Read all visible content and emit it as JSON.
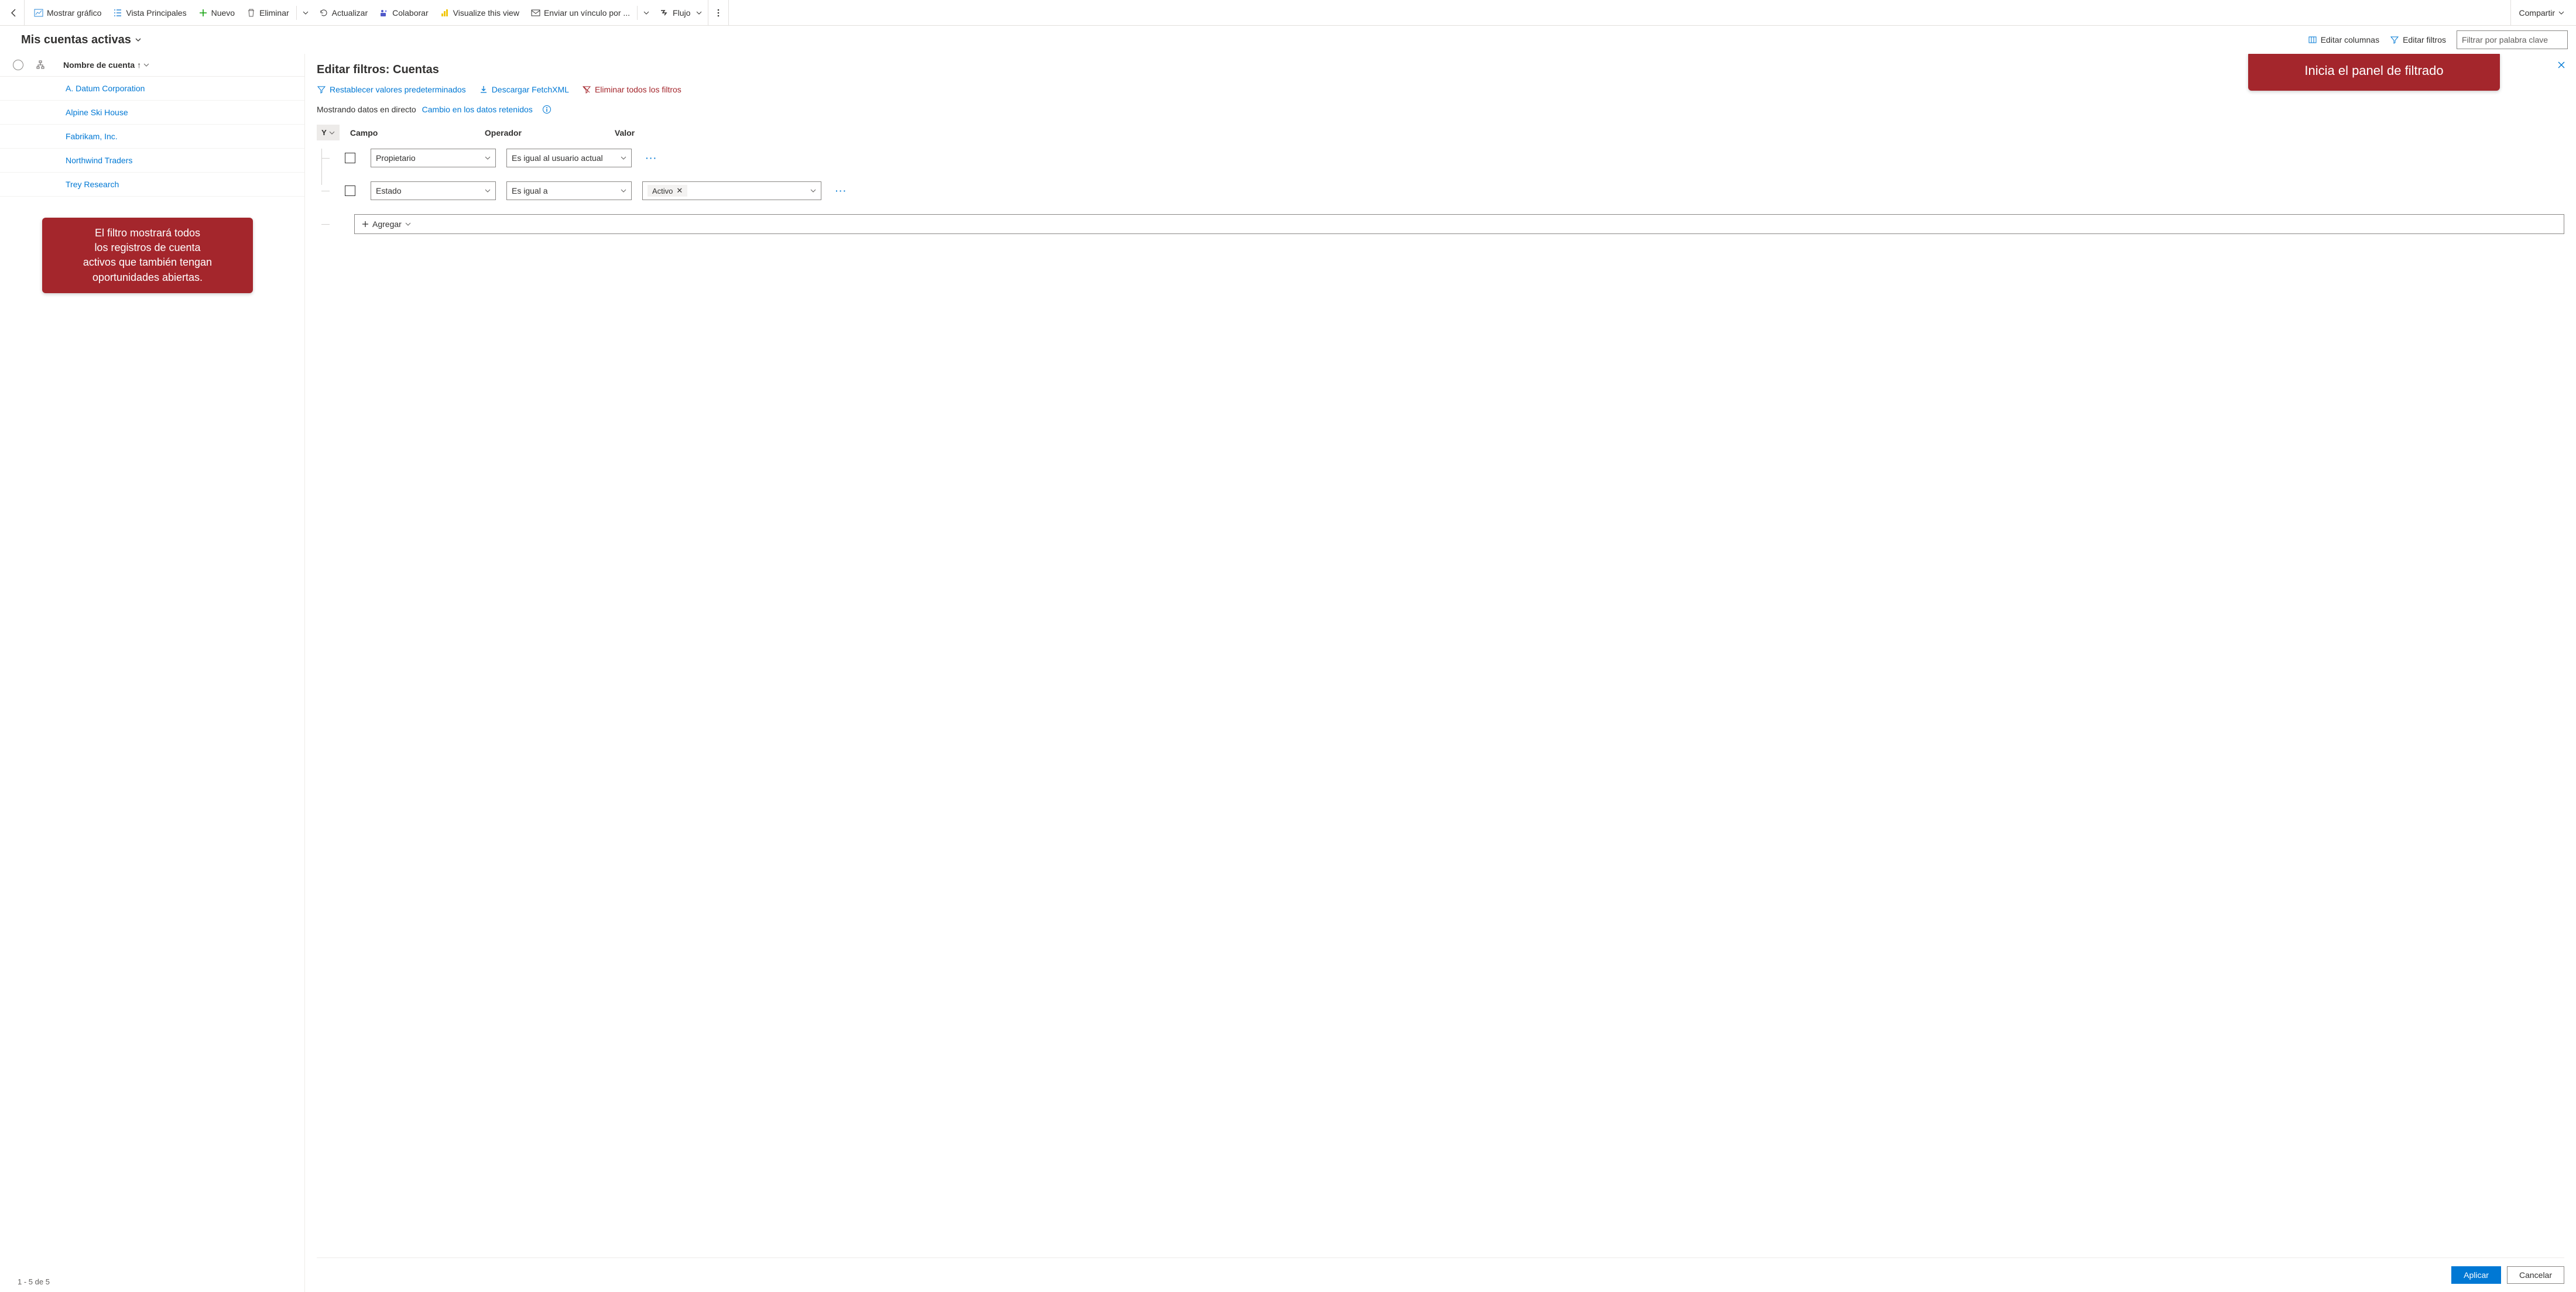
{
  "commandBar": {
    "showChart": "Mostrar gráfico",
    "mainView": "Vista Principales",
    "new": "Nuevo",
    "delete": "Eliminar",
    "refresh": "Actualizar",
    "collaborate": "Colaborar",
    "visualize": "Visualize this view",
    "sendLink": "Enviar un vínculo por ...",
    "flow": "Flujo",
    "share": "Compartir"
  },
  "subBar": {
    "viewTitle": "Mis cuentas activas",
    "editColumns": "Editar columnas",
    "editFilters": "Editar filtros",
    "searchPlaceholder": "Filtrar por palabra clave"
  },
  "columnHeader": {
    "accountName": "Nombre de cuenta",
    "sortIndicator": "↑"
  },
  "rows": [
    "A. Datum Corporation",
    "Alpine Ski House",
    "Fabrikam, Inc.",
    "Northwind Traders",
    "Trey Research"
  ],
  "pager": "1 - 5 de 5",
  "filterPane": {
    "title": "Editar filtros: Cuentas",
    "reset": "Restablecer valores predeterminados",
    "download": "Descargar FetchXML",
    "clearAll": "Eliminar todos los filtros",
    "liveData": "Mostrando datos en directo",
    "retained": "Cambio en los datos retenidos",
    "groupOp": "Y",
    "headers": {
      "field": "Campo",
      "operator": "Operador",
      "value": "Valor"
    },
    "rows": [
      {
        "field": "Propietario",
        "operator": "Es igual al usuario actual",
        "value": null
      },
      {
        "field": "Estado",
        "operator": "Es igual a",
        "value": "Activo"
      }
    ],
    "add": "Agregar",
    "apply": "Aplicar",
    "cancel": "Cancelar"
  },
  "callouts": {
    "top": "Inicia el panel de filtrado",
    "left": "El filtro mostrará todos\nlos registros de cuenta\nactivos que también tengan\noportunidades abiertas."
  }
}
